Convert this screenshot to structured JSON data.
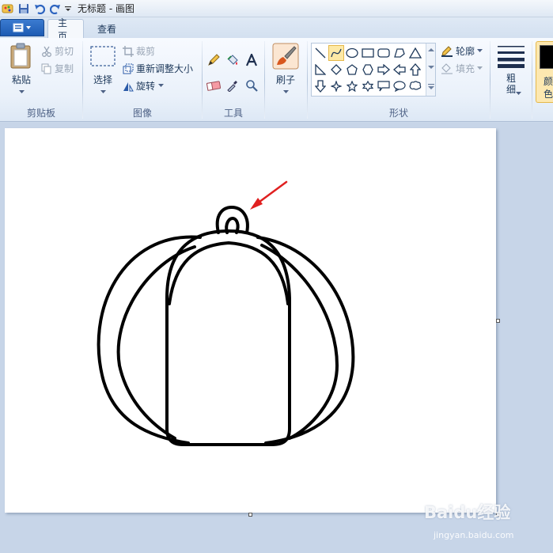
{
  "window": {
    "title": "无标题 - 画图"
  },
  "tabs": {
    "home": "主页",
    "view": "查看"
  },
  "clipboard": {
    "paste": "粘贴",
    "cut": "剪切",
    "copy": "复制",
    "label": "剪贴板"
  },
  "image": {
    "select": "选择",
    "crop": "裁剪",
    "resize": "重新调整大小",
    "rotate": "旋转",
    "label": "图像"
  },
  "tools": {
    "label": "工具"
  },
  "brush": {
    "label": "刷子"
  },
  "shapes": {
    "outline": "轮廓",
    "fill": "填充",
    "label": "形状"
  },
  "size": {
    "label": "粗细"
  },
  "colors": {
    "color1_label": "颜色"
  },
  "accent_colors": {
    "arrow": "#e02020",
    "selected_shape_bg": "#fde9a6",
    "color1": "#000000"
  },
  "watermark": {
    "logo": "Baidu经验",
    "sub": "jingyan.baidu.com"
  }
}
